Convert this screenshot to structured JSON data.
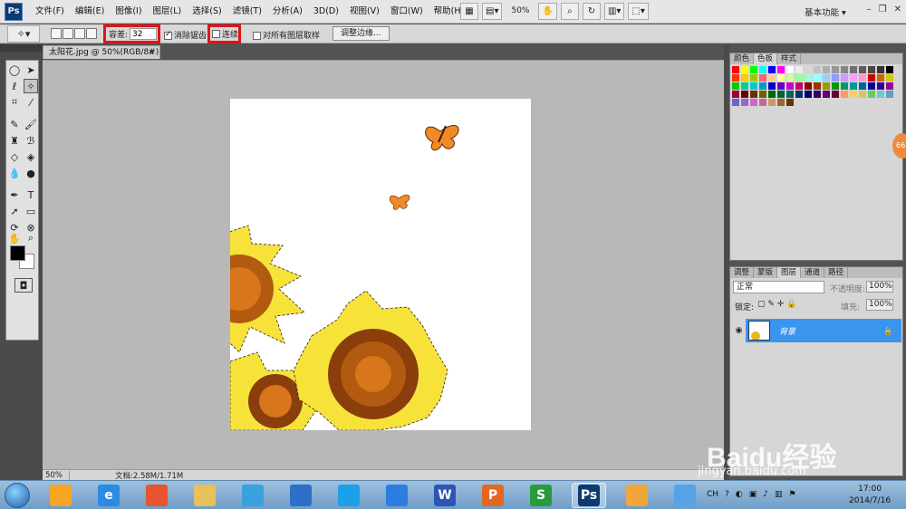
{
  "app": {
    "logo": "Ps",
    "workspace": "基本功能 ▾"
  },
  "menu": [
    "文件(F)",
    "编辑(E)",
    "图像(I)",
    "图层(L)",
    "选择(S)",
    "滤镜(T)",
    "分析(A)",
    "3D(D)",
    "视图(V)",
    "窗口(W)",
    "帮助(H)"
  ],
  "menubar": {
    "zoom": "50%"
  },
  "options": {
    "tolerance_label": "容差:",
    "tolerance_value": "32",
    "antialias_label": "消除锯齿",
    "antialias_checked": true,
    "contiguous_label": "连续",
    "contiguous_checked": false,
    "all_layers_label": "对所有图层取样",
    "refine_edge": "调整边缘..."
  },
  "document": {
    "tab": "太阳花.jpg @ 50%(RGB/8#)",
    "close": "×"
  },
  "status": {
    "zoom": "50%",
    "doc_info": "文档:2.58M/1.71M"
  },
  "swatches_panel": {
    "tabs": [
      "颜色",
      "色板",
      "样式"
    ],
    "selected": "色板",
    "colors": [
      "#ff0000",
      "#ffff00",
      "#00ff00",
      "#00ffff",
      "#0000ff",
      "#ff00ff",
      "#ffffff",
      "#ebebeb",
      "#d6d6d6",
      "#c2c2c2",
      "#adadad",
      "#999999",
      "#858585",
      "#707070",
      "#5c5c5c",
      "#474747",
      "#333333",
      "#000000",
      "#ff3300",
      "#ffcc00",
      "#99cc00",
      "#ff6666",
      "#ffcc99",
      "#ffff99",
      "#ccff99",
      "#99ff99",
      "#99ffcc",
      "#99ffff",
      "#99ccff",
      "#9999ff",
      "#cc99ff",
      "#ff99ff",
      "#ff99cc",
      "#cc0000",
      "#cc6600",
      "#cccc00",
      "#00cc00",
      "#00cc99",
      "#00cccc",
      "#0099cc",
      "#0000cc",
      "#6600cc",
      "#cc00cc",
      "#cc0066",
      "#990000",
      "#993300",
      "#999900",
      "#009900",
      "#009966",
      "#009999",
      "#006699",
      "#000099",
      "#330099",
      "#990099",
      "#990033",
      "#660000",
      "#663300",
      "#666600",
      "#006600",
      "#006633",
      "#006666",
      "#003366",
      "#000066",
      "#330066",
      "#660066",
      "#660033",
      "#ff9966",
      "#ffcc66",
      "#cccc66",
      "#66cc66",
      "#66cccc",
      "#6699cc",
      "#6666cc",
      "#9966cc",
      "#cc66cc",
      "#cc6699",
      "#cc9966",
      "#996633",
      "#663300"
    ]
  },
  "layers_panel": {
    "tabs": [
      "调整",
      "蒙版",
      "图层",
      "通道",
      "路径"
    ],
    "selected": "图层",
    "blend_mode": "正常",
    "opacity_label": "不透明度:",
    "opacity": "100%",
    "lock_label": "锁定:",
    "fill_label": "填充:",
    "fill": "100%",
    "layer_name": "背景"
  },
  "taskbar": {
    "apps": [
      {
        "name": "picture-viewer",
        "color": "#f6a623",
        "glyph": ""
      },
      {
        "name": "ie",
        "color": "#2b8ae2",
        "glyph": "e"
      },
      {
        "name": "browser-360",
        "color": "#e8542d",
        "glyph": ""
      },
      {
        "name": "explorer",
        "color": "#e8c15a",
        "glyph": ""
      },
      {
        "name": "bird-app",
        "color": "#3aa0e0",
        "glyph": ""
      },
      {
        "name": "disc-app",
        "color": "#2e6fc7",
        "glyph": ""
      },
      {
        "name": "qq-browser",
        "color": "#1ca0e8",
        "glyph": ""
      },
      {
        "name": "cloud-app",
        "color": "#2d7ce0",
        "glyph": ""
      },
      {
        "name": "wps-writer",
        "color": "#2d55b5",
        "glyph": "W"
      },
      {
        "name": "wps-presentation",
        "color": "#e46623",
        "glyph": "P"
      },
      {
        "name": "wps-spreadsheet",
        "color": "#2a9a3b",
        "glyph": "S"
      },
      {
        "name": "photoshop",
        "color": "#0d3a6f",
        "glyph": "Ps"
      },
      {
        "name": "gift-app",
        "color": "#f2a53a",
        "glyph": ""
      },
      {
        "name": "paint-app",
        "color": "#57a3e8",
        "glyph": ""
      }
    ],
    "tray_lang": "CH",
    "time": "17:00",
    "date": "2014/7/16"
  },
  "watermark": {
    "brand": "Baidu经验",
    "url": "jingyan.baidu.com"
  },
  "badge": "66"
}
